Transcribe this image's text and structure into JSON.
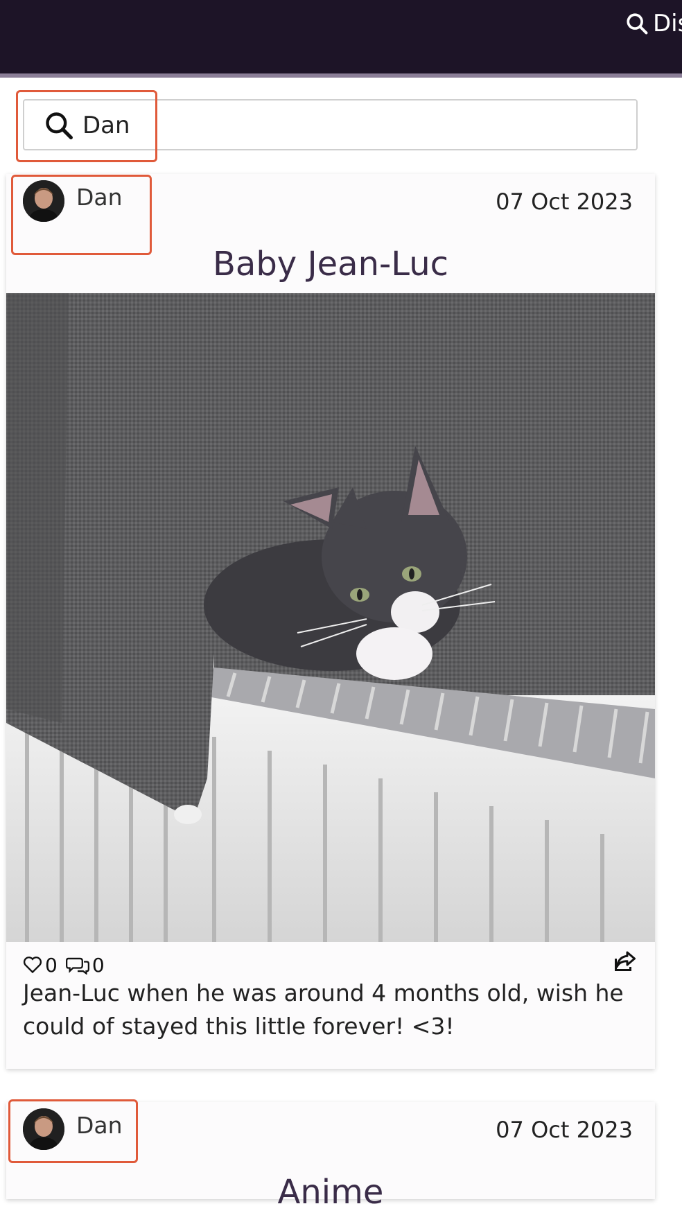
{
  "nav": {
    "discover_label": "Discover"
  },
  "search": {
    "value": "Dan"
  },
  "posts": [
    {
      "author": "Dan",
      "date": "07 Oct 2023",
      "title": "Baby Jean-Luc",
      "likes": "0",
      "comments": "0",
      "body": "Jean-Luc when he was around 4 months old, wish he could of stayed this little forever! <3!"
    },
    {
      "author": "Dan",
      "date": "07 Oct 2023",
      "title": "Anime"
    }
  ]
}
